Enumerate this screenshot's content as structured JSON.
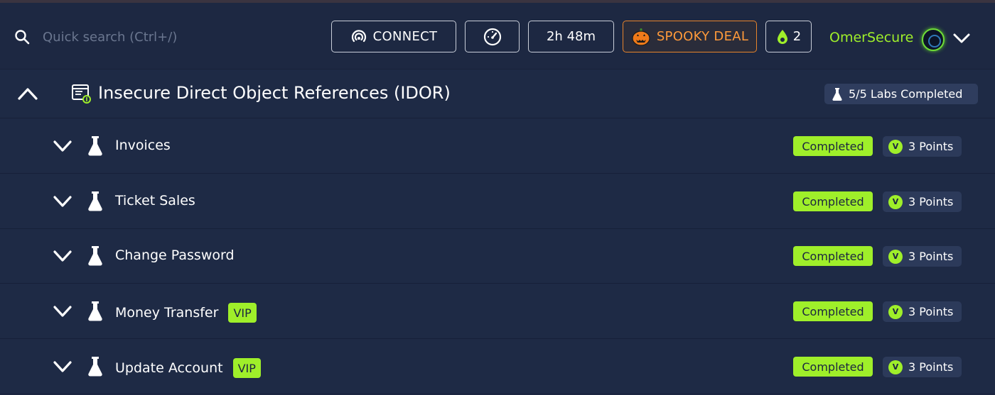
{
  "search": {
    "placeholder": "Quick search (Ctrl+/)"
  },
  "header": {
    "connect_label": "CONNECT",
    "timer": "2h 48m",
    "promo_label": "SPOOKY DEAL",
    "cubes_count": "2",
    "username": "OmerSecure"
  },
  "module": {
    "title": "Insecure Direct Object References (IDOR)",
    "labs_completed": "5/5 Labs Completed"
  },
  "labs": [
    {
      "title": "Invoices",
      "vip": "",
      "status": "Completed",
      "points": "3 Points"
    },
    {
      "title": "Ticket Sales",
      "vip": "",
      "status": "Completed",
      "points": "3 Points"
    },
    {
      "title": "Change Password",
      "vip": "",
      "status": "Completed",
      "points": "3 Points"
    },
    {
      "title": "Money Transfer",
      "vip": "VIP",
      "status": "Completed",
      "points": "3 Points"
    },
    {
      "title": "Update Account",
      "vip": "VIP",
      "status": "Completed",
      "points": "3 Points"
    }
  ],
  "colors": {
    "background": "#1e2a45",
    "accent_green": "#9fef2a",
    "promo_orange": "#ff9a3a",
    "border_light": "#c9ced9"
  },
  "icons": {
    "search": "search-icon",
    "connect": "broadcast-icon",
    "speed": "speedometer-icon",
    "promo": "pumpkin-icon",
    "cubes": "droplet-icon",
    "user_menu": "chevron-down-icon",
    "collapse": "chevron-up-icon",
    "module": "module-icon",
    "lab": "flask-icon",
    "points": "coin-icon"
  }
}
